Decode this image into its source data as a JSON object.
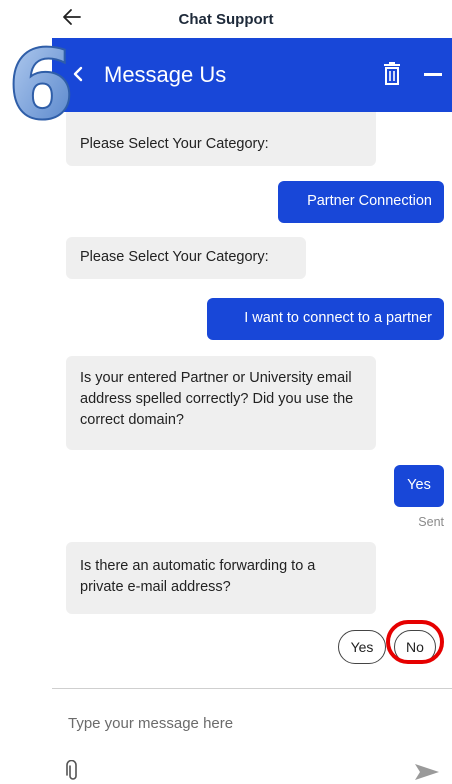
{
  "topbar": {
    "title": "Chat Support"
  },
  "header": {
    "title": "Message Us"
  },
  "step_number": "6",
  "messages": [
    {
      "from": "bot",
      "text": "Please Select Your Category:"
    },
    {
      "from": "user",
      "text": "Partner Connection"
    },
    {
      "from": "bot",
      "text": "Please Select Your Category:"
    },
    {
      "from": "user",
      "text": "I want to connect to a partner"
    },
    {
      "from": "bot",
      "text": "Is your entered Partner or University email address spelled correctly? Did you use the correct domain?"
    },
    {
      "from": "user",
      "text": "Yes"
    },
    {
      "from": "bot",
      "text": "Is there an automatic forwarding to a private e-mail address?"
    }
  ],
  "sent_status": "Sent",
  "quick_replies": [
    {
      "label": "Yes"
    },
    {
      "label": "No"
    }
  ],
  "composer": {
    "placeholder": "Type your message here",
    "value": ""
  },
  "colors": {
    "brand": "#1847d8",
    "highlight": "#e60000",
    "bot_bubble": "#efefef"
  },
  "icons": {
    "back": "arrow-left-icon",
    "header_back": "chevron-left-icon",
    "delete": "trash-icon",
    "minimize": "minus-icon",
    "attach": "paperclip-icon",
    "send": "send-icon"
  }
}
